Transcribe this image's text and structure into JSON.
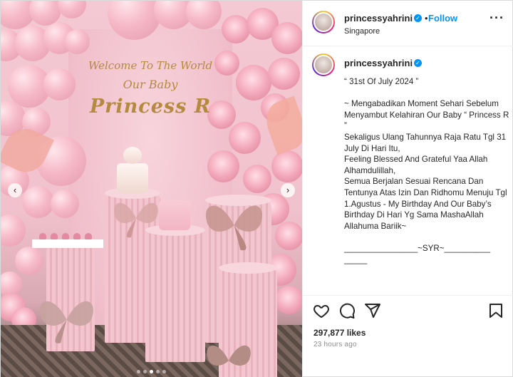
{
  "post": {
    "sign": {
      "line1": "Welcome To The World",
      "line2": "Our Baby",
      "line3": "Princess R"
    },
    "carousel": {
      "slide_count": 5,
      "active_index": 2
    }
  },
  "header": {
    "username": "princessyahrini",
    "separator": "•",
    "follow_label": "Follow",
    "location": "Singapore",
    "more_icon": "more-horizontal-icon"
  },
  "caption": {
    "username": "princessyahrini",
    "text": "“ 31st Of July 2024 ”\n\n~ Mengabadikan Moment Sehari Sebelum Menyambut Kelahiran Our Baby “ Princess R ”\nSekaligus Ulang Tahunnya Raja Ratu Tgl 31 July Di Hari Itu,\nFeeling Blessed And Grateful Yaa Allah\nAlhamdulillah,\nSemua Berjalan Sesuai Rencana Dan Tentunya Atas Izin Dan Ridhomu Menuju Tgl 1.Agustus - My Birthday And Our Baby’s Birthday Di Hari Yg Sama MashaAllah Allahuma Bariik~\n\n________________~SYR~__________\n_____"
  },
  "actions": {
    "like_icon": "heart-icon",
    "comment_icon": "comment-icon",
    "share_icon": "share-icon",
    "save_icon": "bookmark-icon"
  },
  "stats": {
    "likes": "297,877 likes",
    "time": "23 hours ago"
  },
  "colors": {
    "accent": "#0095f6",
    "text": "#262626",
    "muted": "#8e8e8e"
  }
}
